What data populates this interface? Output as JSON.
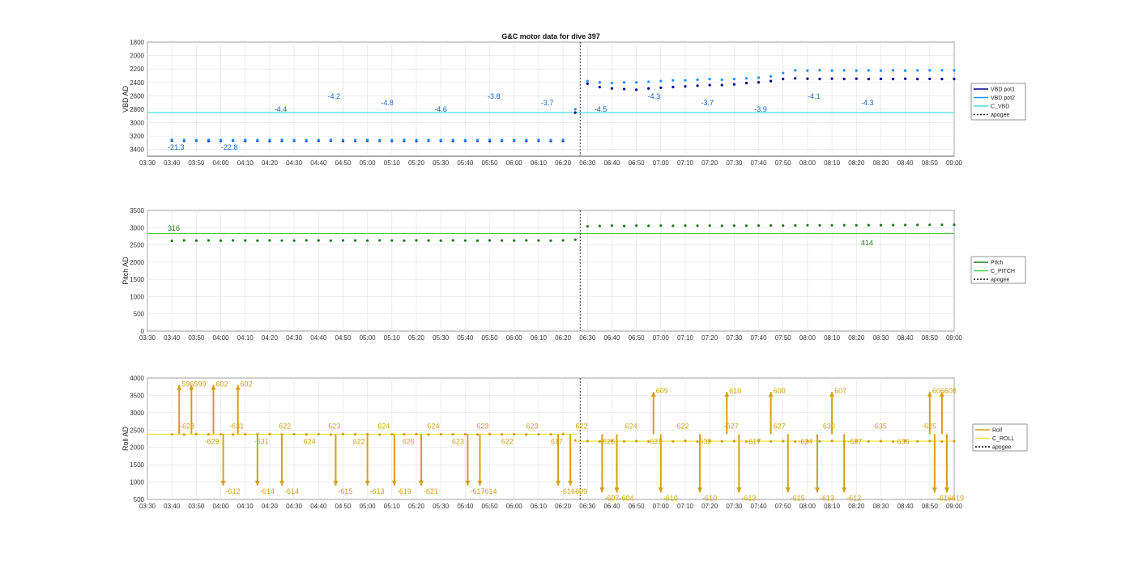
{
  "figure_title": "G&C motor data for dive 397",
  "chart_data": [
    {
      "type": "line",
      "ylabel": "VBD AD",
      "xlabel": "",
      "y_reversed": true,
      "ylim": [
        1800,
        3500
      ],
      "yticks": [
        1800,
        2000,
        2200,
        2400,
        2600,
        2800,
        3000,
        3200,
        3400
      ],
      "grid": true,
      "legend_position": "right",
      "legend": [
        {
          "label": "VBD pot1",
          "color": "#00008b"
        },
        {
          "label": "VBD pot2",
          "color": "#1e90ff"
        },
        {
          "label": "C_VBD",
          "color": "#40e0e0"
        },
        {
          "label": "apogee",
          "color": "#000000",
          "dashed": true
        }
      ],
      "reference_lines": [
        {
          "name": "C_VBD",
          "y": 2850,
          "color": "#40e0e0"
        }
      ],
      "series": [
        {
          "name": "VBD pot1",
          "color": "#00008b",
          "x": [
            "03:40",
            "03:45",
            "03:50",
            "03:55",
            "04:00",
            "04:05",
            "04:10",
            "04:15",
            "04:20",
            "04:25",
            "04:30",
            "04:35",
            "04:40",
            "04:45",
            "04:50",
            "04:55",
            "05:00",
            "05:05",
            "05:10",
            "05:15",
            "05:20",
            "05:25",
            "05:30",
            "05:35",
            "05:40",
            "05:45",
            "05:50",
            "05:55",
            "06:00",
            "06:05",
            "06:10",
            "06:15",
            "06:20",
            "06:25",
            "06:30",
            "06:35",
            "06:40",
            "06:45",
            "06:50",
            "06:55",
            "07:00",
            "07:05",
            "07:10",
            "07:15",
            "07:20",
            "07:25",
            "07:30",
            "07:35",
            "07:40",
            "07:45",
            "07:50",
            "07:55",
            "08:00",
            "08:05",
            "08:10",
            "08:15",
            "08:20",
            "08:25",
            "08:30",
            "08:35",
            "08:40",
            "08:45",
            "08:50",
            "08:55",
            "09:00"
          ],
          "values": [
            3265,
            3270,
            3268,
            3272,
            3270,
            3268,
            3271,
            3270,
            3272,
            3269,
            3270,
            3271,
            3270,
            3268,
            3272,
            3270,
            3269,
            3270,
            3271,
            3270,
            3272,
            3268,
            3270,
            3271,
            3269,
            3270,
            3272,
            3270,
            3268,
            3271,
            3270,
            3272,
            3270,
            2850,
            2420,
            2470,
            2490,
            2500,
            2510,
            2490,
            2480,
            2470,
            2460,
            2450,
            2440,
            2440,
            2430,
            2410,
            2400,
            2380,
            2350,
            2340,
            2345,
            2350,
            2345,
            2350,
            2345,
            2350,
            2348,
            2350,
            2345,
            2350,
            2348,
            2350,
            2350
          ]
        },
        {
          "name": "VBD pot2",
          "color": "#1e90ff",
          "x": [
            "03:40",
            "03:45",
            "03:50",
            "03:55",
            "04:00",
            "04:05",
            "04:10",
            "04:15",
            "04:20",
            "04:25",
            "04:30",
            "04:35",
            "04:40",
            "04:45",
            "04:50",
            "04:55",
            "05:00",
            "05:05",
            "05:10",
            "05:15",
            "05:20",
            "05:25",
            "05:30",
            "05:35",
            "05:40",
            "05:45",
            "05:50",
            "05:55",
            "06:00",
            "06:05",
            "06:10",
            "06:15",
            "06:20",
            "06:25",
            "06:30",
            "06:35",
            "06:40",
            "06:45",
            "06:50",
            "06:55",
            "07:00",
            "07:05",
            "07:10",
            "07:15",
            "07:20",
            "07:25",
            "07:30",
            "07:35",
            "07:40",
            "07:45",
            "07:50",
            "07:55",
            "08:00",
            "08:05",
            "08:10",
            "08:15",
            "08:20",
            "08:25",
            "08:30",
            "08:35",
            "08:40",
            "08:45",
            "08:50",
            "08:55",
            "09:00"
          ],
          "values": [
            3255,
            3258,
            3260,
            3256,
            3258,
            3260,
            3257,
            3258,
            3259,
            3256,
            3258,
            3260,
            3258,
            3256,
            3259,
            3258,
            3257,
            3260,
            3258,
            3256,
            3258,
            3259,
            3258,
            3257,
            3260,
            3258,
            3256,
            3258,
            3259,
            3258,
            3257,
            3258,
            3255,
            2800,
            2380,
            2400,
            2410,
            2400,
            2400,
            2390,
            2380,
            2370,
            2370,
            2360,
            2350,
            2360,
            2350,
            2340,
            2330,
            2310,
            2260,
            2220,
            2225,
            2220,
            2225,
            2220,
            2225,
            2222,
            2225,
            2220,
            2225,
            2222,
            2222,
            2220,
            2222
          ]
        }
      ],
      "annotations": [
        "-21.3",
        "-22.8",
        "-4.4",
        "-4.2",
        "-4.8",
        "-4.6",
        "-3.8",
        "-3.7",
        "-4.5",
        "-4.3",
        "-3.7",
        "-3.9",
        "-4.1",
        "-4.3"
      ]
    },
    {
      "type": "line",
      "ylabel": "Pitch AD",
      "xlabel": "",
      "ylim": [
        0,
        3500
      ],
      "yticks": [
        0,
        500,
        1000,
        1500,
        2000,
        2500,
        3000,
        3500
      ],
      "grid": true,
      "legend_position": "right",
      "legend": [
        {
          "label": "Pitch",
          "color": "#1f7a1f"
        },
        {
          "label": "C_PITCH",
          "color": "#44cc44"
        },
        {
          "label": "apogee",
          "color": "#000000",
          "dashed": true
        }
      ],
      "reference_lines": [
        {
          "name": "C_PITCH",
          "y": 2830,
          "color": "#44cc44"
        }
      ],
      "series": [
        {
          "name": "Pitch",
          "color": "#1f7a1f",
          "x": [
            "03:40",
            "03:45",
            "03:50",
            "03:55",
            "04:00",
            "04:05",
            "04:10",
            "04:15",
            "04:20",
            "04:25",
            "04:30",
            "04:35",
            "04:40",
            "04:45",
            "04:50",
            "04:55",
            "05:00",
            "05:05",
            "05:10",
            "05:15",
            "05:20",
            "05:25",
            "05:30",
            "05:35",
            "05:40",
            "05:45",
            "05:50",
            "05:55",
            "06:00",
            "06:05",
            "06:10",
            "06:15",
            "06:20",
            "06:25",
            "06:30",
            "06:35",
            "06:40",
            "06:45",
            "06:50",
            "06:55",
            "07:00",
            "07:05",
            "07:10",
            "07:15",
            "07:20",
            "07:25",
            "07:30",
            "07:35",
            "07:40",
            "07:45",
            "07:50",
            "07:55",
            "08:00",
            "08:05",
            "08:10",
            "08:15",
            "08:20",
            "08:25",
            "08:30",
            "08:35",
            "08:40",
            "08:45",
            "08:50",
            "08:55",
            "09:00"
          ],
          "values": [
            2620,
            2630,
            2625,
            2630,
            2625,
            2630,
            2628,
            2625,
            2630,
            2627,
            2625,
            2630,
            2628,
            2625,
            2630,
            2628,
            2626,
            2630,
            2628,
            2625,
            2630,
            2628,
            2625,
            2630,
            2627,
            2625,
            2630,
            2628,
            2626,
            2630,
            2628,
            2625,
            2630,
            2650,
            3040,
            3050,
            3060,
            3050,
            3060,
            3055,
            3060,
            3055,
            3060,
            3058,
            3060,
            3055,
            3060,
            3058,
            3060,
            3062,
            3060,
            3065,
            3070,
            3068,
            3070,
            3072,
            3070,
            3075,
            3072,
            3075,
            3078,
            3080,
            3082,
            3085,
            3085
          ]
        }
      ],
      "annotations": [
        "316",
        "414"
      ]
    },
    {
      "type": "line",
      "ylabel": "Roll AD",
      "xlabel": "",
      "ylim": [
        500,
        4000
      ],
      "yticks": [
        500,
        1000,
        1500,
        2000,
        2500,
        3000,
        3500,
        4000
      ],
      "grid": true,
      "legend_position": "right",
      "legend": [
        {
          "label": "Roll",
          "color": "#d4a017"
        },
        {
          "label": "C_ROLL",
          "color": "#f0e040"
        },
        {
          "label": "apogee",
          "color": "#000000",
          "dashed": true
        }
      ],
      "reference_lines": [
        {
          "name": "C_ROLL",
          "y": 2380,
          "x_range": [
            "03:30",
            "06:26"
          ],
          "color": "#f0e040"
        },
        {
          "name": "C_ROLL",
          "y": 2180,
          "x_range": [
            "06:26",
            "09:00"
          ],
          "color": "#f0e040"
        }
      ],
      "series": [
        {
          "name": "Roll",
          "color": "#d4a017",
          "x": [
            "03:40",
            "03:45",
            "03:50",
            "03:55",
            "04:00",
            "04:05",
            "04:10",
            "04:15",
            "04:20",
            "04:25",
            "04:30",
            "04:35",
            "04:40",
            "04:45",
            "04:50",
            "04:55",
            "05:00",
            "05:05",
            "05:10",
            "05:15",
            "05:20",
            "05:25",
            "05:30",
            "05:35",
            "05:40",
            "05:45",
            "05:50",
            "05:55",
            "06:00",
            "06:05",
            "06:10",
            "06:15",
            "06:20",
            "06:25",
            "06:30",
            "06:35",
            "06:40",
            "06:45",
            "06:50",
            "06:55",
            "07:00",
            "07:05",
            "07:10",
            "07:15",
            "07:20",
            "07:25",
            "07:30",
            "07:35",
            "07:40",
            "07:45",
            "07:50",
            "07:55",
            "08:00",
            "08:05",
            "08:10",
            "08:15",
            "08:20",
            "08:25",
            "08:30",
            "08:35",
            "08:40",
            "08:45",
            "08:50",
            "08:55",
            "09:00"
          ],
          "values": [
            2380,
            2370,
            2385,
            2375,
            2380,
            2370,
            2380,
            2375,
            2385,
            2370,
            2380,
            2375,
            2380,
            2370,
            2385,
            2375,
            2380,
            2370,
            2380,
            2375,
            2385,
            2370,
            2380,
            2375,
            2380,
            2370,
            2385,
            2375,
            2380,
            2370,
            2380,
            2375,
            2385,
            2200,
            2180,
            2170,
            2185,
            2175,
            2180,
            2170,
            2180,
            2175,
            2185,
            2170,
            2180,
            2175,
            2180,
            2170,
            2185,
            2175,
            2180,
            2170,
            2180,
            2175,
            2185,
            2170,
            2180,
            2175,
            2180,
            2170,
            2185,
            2175,
            2180,
            2170,
            2180
          ]
        }
      ],
      "roll_events": [
        {
          "t": "03:43",
          "up": 3800,
          "down": null,
          "labels": [
            "596"
          ]
        },
        {
          "t": "03:48",
          "up": 3800,
          "down": null,
          "labels": [
            "599"
          ]
        },
        {
          "t": "03:57",
          "up": 3800,
          "down": null,
          "labels": [
            "602"
          ]
        },
        {
          "t": "04:07",
          "up": 3800,
          "down": null,
          "labels": [
            "602"
          ]
        },
        {
          "t": "04:01",
          "up": null,
          "down": 900,
          "labels": [
            "-612"
          ]
        },
        {
          "t": "04:15",
          "up": null,
          "down": 900,
          "labels": [
            "-614"
          ]
        },
        {
          "t": "04:25",
          "up": null,
          "down": 900,
          "labels": [
            "-614"
          ]
        },
        {
          "t": "04:47",
          "up": null,
          "down": 900,
          "labels": [
            "-615"
          ]
        },
        {
          "t": "05:00",
          "up": null,
          "down": 900,
          "labels": [
            "-613"
          ]
        },
        {
          "t": "05:11",
          "up": null,
          "down": 900,
          "labels": [
            "-619"
          ]
        },
        {
          "t": "05:22",
          "up": null,
          "down": 900,
          "labels": [
            "-621"
          ]
        },
        {
          "t": "05:41",
          "up": null,
          "down": 900,
          "labels": [
            "-617"
          ]
        },
        {
          "t": "05:46",
          "up": null,
          "down": 900,
          "labels": [
            "-614"
          ]
        },
        {
          "t": "06:18",
          "up": null,
          "down": 900,
          "labels": [
            "-616"
          ]
        },
        {
          "t": "06:23",
          "up": null,
          "down": 900,
          "labels": [
            "-609"
          ]
        },
        {
          "t": "06:36",
          "up": null,
          "down": 700,
          "labels": [
            "-607"
          ]
        },
        {
          "t": "06:42",
          "up": null,
          "down": 700,
          "labels": [
            "-604"
          ]
        },
        {
          "t": "06:57",
          "up": 3600,
          "down": null,
          "labels": [
            "609"
          ]
        },
        {
          "t": "07:00",
          "up": null,
          "down": 700,
          "labels": [
            "-610"
          ]
        },
        {
          "t": "07:16",
          "up": null,
          "down": 700,
          "labels": [
            "-610"
          ]
        },
        {
          "t": "07:27",
          "up": 3600,
          "down": null,
          "labels": [
            "610"
          ]
        },
        {
          "t": "07:32",
          "up": null,
          "down": 700,
          "labels": [
            "-613"
          ]
        },
        {
          "t": "07:45",
          "up": 3600,
          "down": null,
          "labels": [
            "600"
          ]
        },
        {
          "t": "07:52",
          "up": null,
          "down": 700,
          "labels": [
            "-615"
          ]
        },
        {
          "t": "08:04",
          "up": null,
          "down": 700,
          "labels": [
            "-613"
          ]
        },
        {
          "t": "08:10",
          "up": 3600,
          "down": null,
          "labels": [
            "607"
          ]
        },
        {
          "t": "08:15",
          "up": null,
          "down": 700,
          "labels": [
            "-612"
          ]
        },
        {
          "t": "08:50",
          "up": 3600,
          "down": null,
          "labels": [
            "606"
          ]
        },
        {
          "t": "08:55",
          "up": 3600,
          "down": null,
          "labels": [
            "608"
          ]
        },
        {
          "t": "08:52",
          "up": null,
          "down": 700,
          "labels": [
            "-616"
          ]
        },
        {
          "t": "08:57",
          "up": null,
          "down": 700,
          "labels": [
            "-619"
          ]
        }
      ],
      "annotations": [
        "-628",
        "-629",
        "-631",
        "-631",
        "622",
        "624",
        "623",
        "622",
        "624",
        "626",
        "624",
        "623",
        "623",
        "622",
        "623",
        "617",
        "622",
        "-626",
        "624",
        "631",
        "-622",
        "632",
        "-627",
        "617",
        "627",
        "-624",
        "630",
        "-627",
        "-635",
        "636",
        "-625"
      ]
    }
  ],
  "x_axis": {
    "tick_labels": [
      "03:30",
      "03:40",
      "03:50",
      "04:00",
      "04:10",
      "04:20",
      "04:30",
      "04:40",
      "04:50",
      "05:00",
      "05:10",
      "05:20",
      "05:30",
      "05:40",
      "05:50",
      "06:00",
      "06:10",
      "06:20",
      "06:30",
      "06:40",
      "06:50",
      "07:00",
      "07:10",
      "07:20",
      "07:30",
      "07:40",
      "07:50",
      "08:00",
      "08:10",
      "08:20",
      "08:30",
      "08:40",
      "08:50",
      "09:00"
    ],
    "range": [
      "03:30",
      "09:00"
    ],
    "apogee": "06:27"
  }
}
